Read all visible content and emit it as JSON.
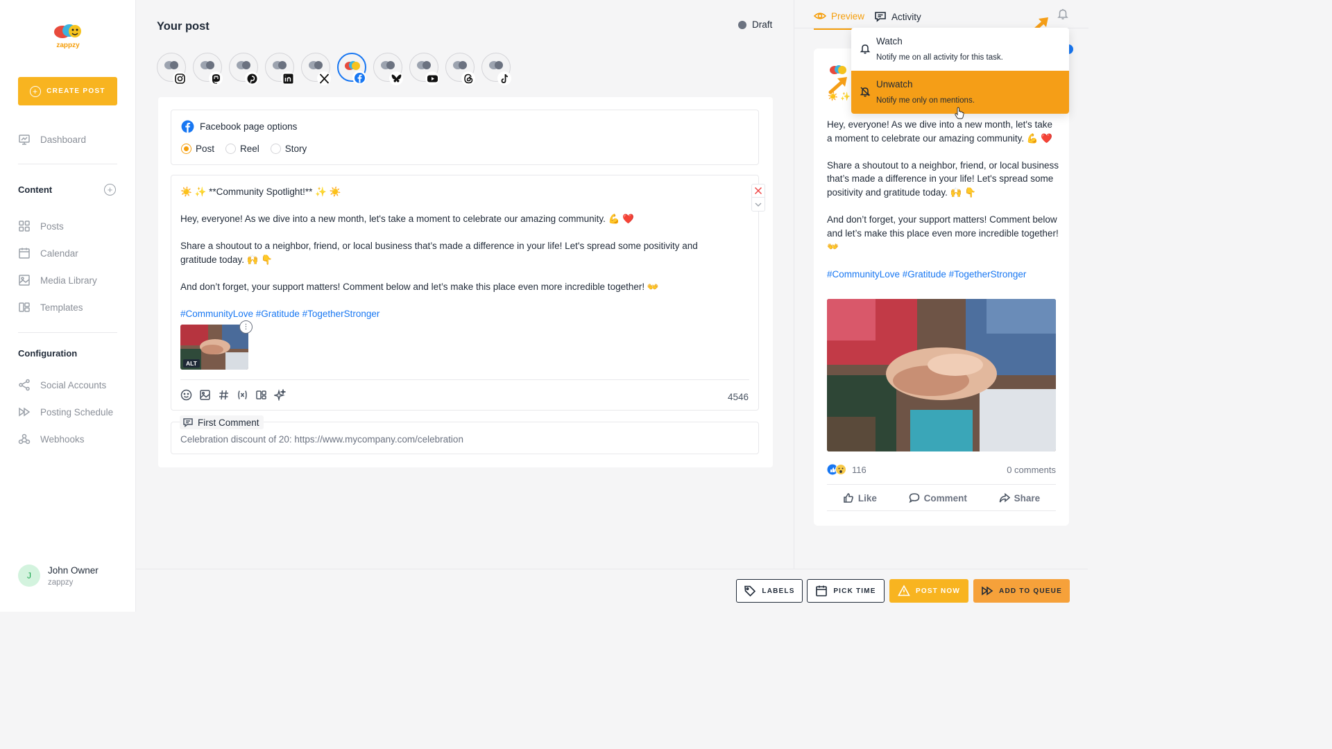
{
  "brand": {
    "name": "zappzy",
    "accent": "#f8b420"
  },
  "sidebar": {
    "create_label": "CREATE POST",
    "dashboard": "Dashboard",
    "content_title": "Content",
    "content_items": [
      "Posts",
      "Calendar",
      "Media Library",
      "Templates"
    ],
    "config_title": "Configuration",
    "config_items": [
      "Social Accounts",
      "Posting Schedule",
      "Webhooks"
    ],
    "user": {
      "initial": "J",
      "name": "John Owner",
      "org": "zappzy"
    }
  },
  "main": {
    "title": "Your post",
    "status": "Draft",
    "accounts": [
      "instagram",
      "mastodon",
      "pinterest",
      "linkedin",
      "x",
      "facebook",
      "bluesky",
      "youtube",
      "threads",
      "tiktok"
    ],
    "fb_options": {
      "title": "Facebook page options",
      "post": "Post",
      "reel": "Reel",
      "story": "Story"
    },
    "composer": {
      "line1": "☀️ ✨ **Community Spotlight!** ✨ ☀️",
      "line2": "Hey, everyone! As we dive into a new month, let's take a moment to celebrate our amazing community. 💪 ❤️",
      "line3": "Share a shoutout to a neighbor, friend, or local business that’s made a difference in your life! Let's spread some positivity and gratitude today. 🙌 👇",
      "line4": "And don’t forget, your support matters! Comment below and let’s make this place even more incredible together! 👐",
      "hashtags": "#CommunityLove #Gratitude #TogetherStronger",
      "alt": "ALT",
      "char_count": "4546"
    },
    "first_comment": {
      "label": "First Comment",
      "text": "Celebration discount of 20: https://www.mycompany.com/celebration"
    }
  },
  "bottom": {
    "labels": "LABELS",
    "pick_time": "PICK TIME",
    "post_now": "POST NOW",
    "add_queue": "ADD TO QUEUE"
  },
  "right": {
    "tab_preview": "Preview",
    "tab_activity": "Activity",
    "preview": {
      "emoji": "☀️ ✨",
      "p1": "Hey, everyone! As we dive into a new month, let's take a moment to celebrate our amazing community. 💪 ❤️",
      "p2": "Share a shoutout to a neighbor, friend, or local business that’s made a difference in your life! Let's spread some positivity and gratitude today. 🙌 👇",
      "p3": "And don’t forget, your support matters! Comment below and let’s make this place even more incredible together! 👐",
      "hashtags": "#CommunityLove #Gratitude #TogetherStronger",
      "reactions": "116",
      "comments": "0 comments",
      "like": "Like",
      "comment": "Comment",
      "share": "Share"
    },
    "dropdown": {
      "watch_title": "Watch",
      "watch_desc": "Notify me on all activity for this task.",
      "unwatch_title": "Unwatch",
      "unwatch_desc": "Notify me only on mentions."
    }
  }
}
